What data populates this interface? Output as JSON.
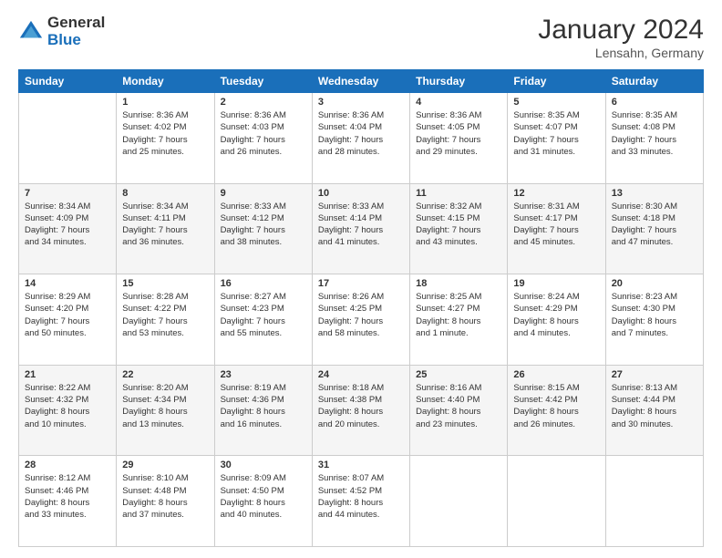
{
  "logo": {
    "general": "General",
    "blue": "Blue"
  },
  "header": {
    "month": "January 2024",
    "location": "Lensahn, Germany"
  },
  "weekdays": [
    "Sunday",
    "Monday",
    "Tuesday",
    "Wednesday",
    "Thursday",
    "Friday",
    "Saturday"
  ],
  "weeks": [
    [
      {
        "day": "",
        "info": ""
      },
      {
        "day": "1",
        "info": "Sunrise: 8:36 AM\nSunset: 4:02 PM\nDaylight: 7 hours\nand 25 minutes."
      },
      {
        "day": "2",
        "info": "Sunrise: 8:36 AM\nSunset: 4:03 PM\nDaylight: 7 hours\nand 26 minutes."
      },
      {
        "day": "3",
        "info": "Sunrise: 8:36 AM\nSunset: 4:04 PM\nDaylight: 7 hours\nand 28 minutes."
      },
      {
        "day": "4",
        "info": "Sunrise: 8:36 AM\nSunset: 4:05 PM\nDaylight: 7 hours\nand 29 minutes."
      },
      {
        "day": "5",
        "info": "Sunrise: 8:35 AM\nSunset: 4:07 PM\nDaylight: 7 hours\nand 31 minutes."
      },
      {
        "day": "6",
        "info": "Sunrise: 8:35 AM\nSunset: 4:08 PM\nDaylight: 7 hours\nand 33 minutes."
      }
    ],
    [
      {
        "day": "7",
        "info": "Sunrise: 8:34 AM\nSunset: 4:09 PM\nDaylight: 7 hours\nand 34 minutes."
      },
      {
        "day": "8",
        "info": "Sunrise: 8:34 AM\nSunset: 4:11 PM\nDaylight: 7 hours\nand 36 minutes."
      },
      {
        "day": "9",
        "info": "Sunrise: 8:33 AM\nSunset: 4:12 PM\nDaylight: 7 hours\nand 38 minutes."
      },
      {
        "day": "10",
        "info": "Sunrise: 8:33 AM\nSunset: 4:14 PM\nDaylight: 7 hours\nand 41 minutes."
      },
      {
        "day": "11",
        "info": "Sunrise: 8:32 AM\nSunset: 4:15 PM\nDaylight: 7 hours\nand 43 minutes."
      },
      {
        "day": "12",
        "info": "Sunrise: 8:31 AM\nSunset: 4:17 PM\nDaylight: 7 hours\nand 45 minutes."
      },
      {
        "day": "13",
        "info": "Sunrise: 8:30 AM\nSunset: 4:18 PM\nDaylight: 7 hours\nand 47 minutes."
      }
    ],
    [
      {
        "day": "14",
        "info": "Sunrise: 8:29 AM\nSunset: 4:20 PM\nDaylight: 7 hours\nand 50 minutes."
      },
      {
        "day": "15",
        "info": "Sunrise: 8:28 AM\nSunset: 4:22 PM\nDaylight: 7 hours\nand 53 minutes."
      },
      {
        "day": "16",
        "info": "Sunrise: 8:27 AM\nSunset: 4:23 PM\nDaylight: 7 hours\nand 55 minutes."
      },
      {
        "day": "17",
        "info": "Sunrise: 8:26 AM\nSunset: 4:25 PM\nDaylight: 7 hours\nand 58 minutes."
      },
      {
        "day": "18",
        "info": "Sunrise: 8:25 AM\nSunset: 4:27 PM\nDaylight: 8 hours\nand 1 minute."
      },
      {
        "day": "19",
        "info": "Sunrise: 8:24 AM\nSunset: 4:29 PM\nDaylight: 8 hours\nand 4 minutes."
      },
      {
        "day": "20",
        "info": "Sunrise: 8:23 AM\nSunset: 4:30 PM\nDaylight: 8 hours\nand 7 minutes."
      }
    ],
    [
      {
        "day": "21",
        "info": "Sunrise: 8:22 AM\nSunset: 4:32 PM\nDaylight: 8 hours\nand 10 minutes."
      },
      {
        "day": "22",
        "info": "Sunrise: 8:20 AM\nSunset: 4:34 PM\nDaylight: 8 hours\nand 13 minutes."
      },
      {
        "day": "23",
        "info": "Sunrise: 8:19 AM\nSunset: 4:36 PM\nDaylight: 8 hours\nand 16 minutes."
      },
      {
        "day": "24",
        "info": "Sunrise: 8:18 AM\nSunset: 4:38 PM\nDaylight: 8 hours\nand 20 minutes."
      },
      {
        "day": "25",
        "info": "Sunrise: 8:16 AM\nSunset: 4:40 PM\nDaylight: 8 hours\nand 23 minutes."
      },
      {
        "day": "26",
        "info": "Sunrise: 8:15 AM\nSunset: 4:42 PM\nDaylight: 8 hours\nand 26 minutes."
      },
      {
        "day": "27",
        "info": "Sunrise: 8:13 AM\nSunset: 4:44 PM\nDaylight: 8 hours\nand 30 minutes."
      }
    ],
    [
      {
        "day": "28",
        "info": "Sunrise: 8:12 AM\nSunset: 4:46 PM\nDaylight: 8 hours\nand 33 minutes."
      },
      {
        "day": "29",
        "info": "Sunrise: 8:10 AM\nSunset: 4:48 PM\nDaylight: 8 hours\nand 37 minutes."
      },
      {
        "day": "30",
        "info": "Sunrise: 8:09 AM\nSunset: 4:50 PM\nDaylight: 8 hours\nand 40 minutes."
      },
      {
        "day": "31",
        "info": "Sunrise: 8:07 AM\nSunset: 4:52 PM\nDaylight: 8 hours\nand 44 minutes."
      },
      {
        "day": "",
        "info": ""
      },
      {
        "day": "",
        "info": ""
      },
      {
        "day": "",
        "info": ""
      }
    ]
  ]
}
